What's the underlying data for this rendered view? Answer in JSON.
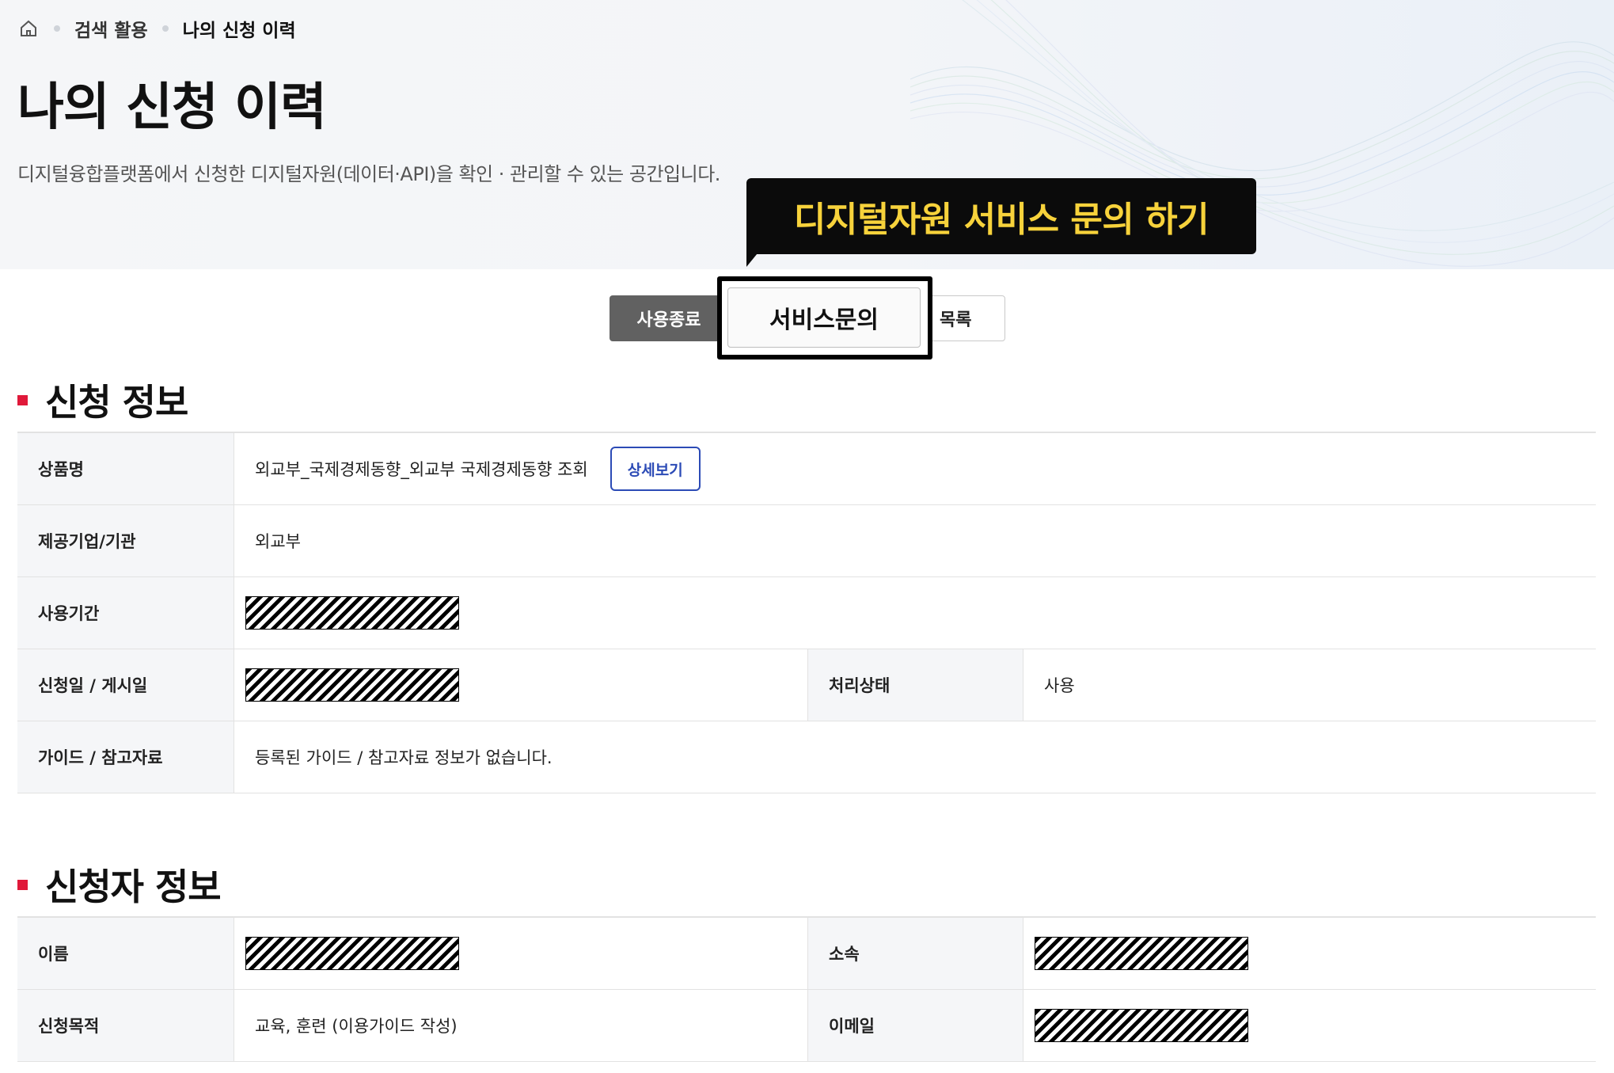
{
  "breadcrumb": {
    "home_icon": "home-icon",
    "items": [
      "검색 활용",
      "나의 신청 이력"
    ]
  },
  "page": {
    "title": "나의 신청 이력",
    "description": "디지털융합플랫폼에서 신청한 디지털자원(데이터·API)을 확인 · 관리할 수 있는 공간입니다."
  },
  "callout": {
    "text": "디지털자원 서비스 문의 하기"
  },
  "actions": {
    "end_label": "사용종료",
    "inquiry_label": "서비스문의",
    "list_label": "목록"
  },
  "application_info": {
    "title": "신청 정보",
    "product_label": "상품명",
    "product_value": "외교부_국제경제동향_외교부 국제경제동향 조회",
    "detail_button": "상세보기",
    "provider_label": "제공기업/기관",
    "provider_value": "외교부",
    "period_label": "사용기간",
    "dates_label": "신청일 / 게시일",
    "status_label": "처리상태",
    "status_value": "사용",
    "guide_label": "가이드 / 참고자료",
    "guide_value": "등록된 가이드 / 참고자료 정보가 없습니다."
  },
  "applicant_info": {
    "title": "신청자 정보",
    "name_label": "이름",
    "affiliation_label": "소속",
    "purpose_label": "신청목적",
    "purpose_value": "교육, 훈련 (이용가이드 작성)",
    "email_label": "이메일"
  },
  "colors": {
    "accent_red": "#e0193a",
    "callout_bg": "#0b0b0b",
    "callout_text": "#f7d23b",
    "detail_blue": "#2c4bb6"
  }
}
